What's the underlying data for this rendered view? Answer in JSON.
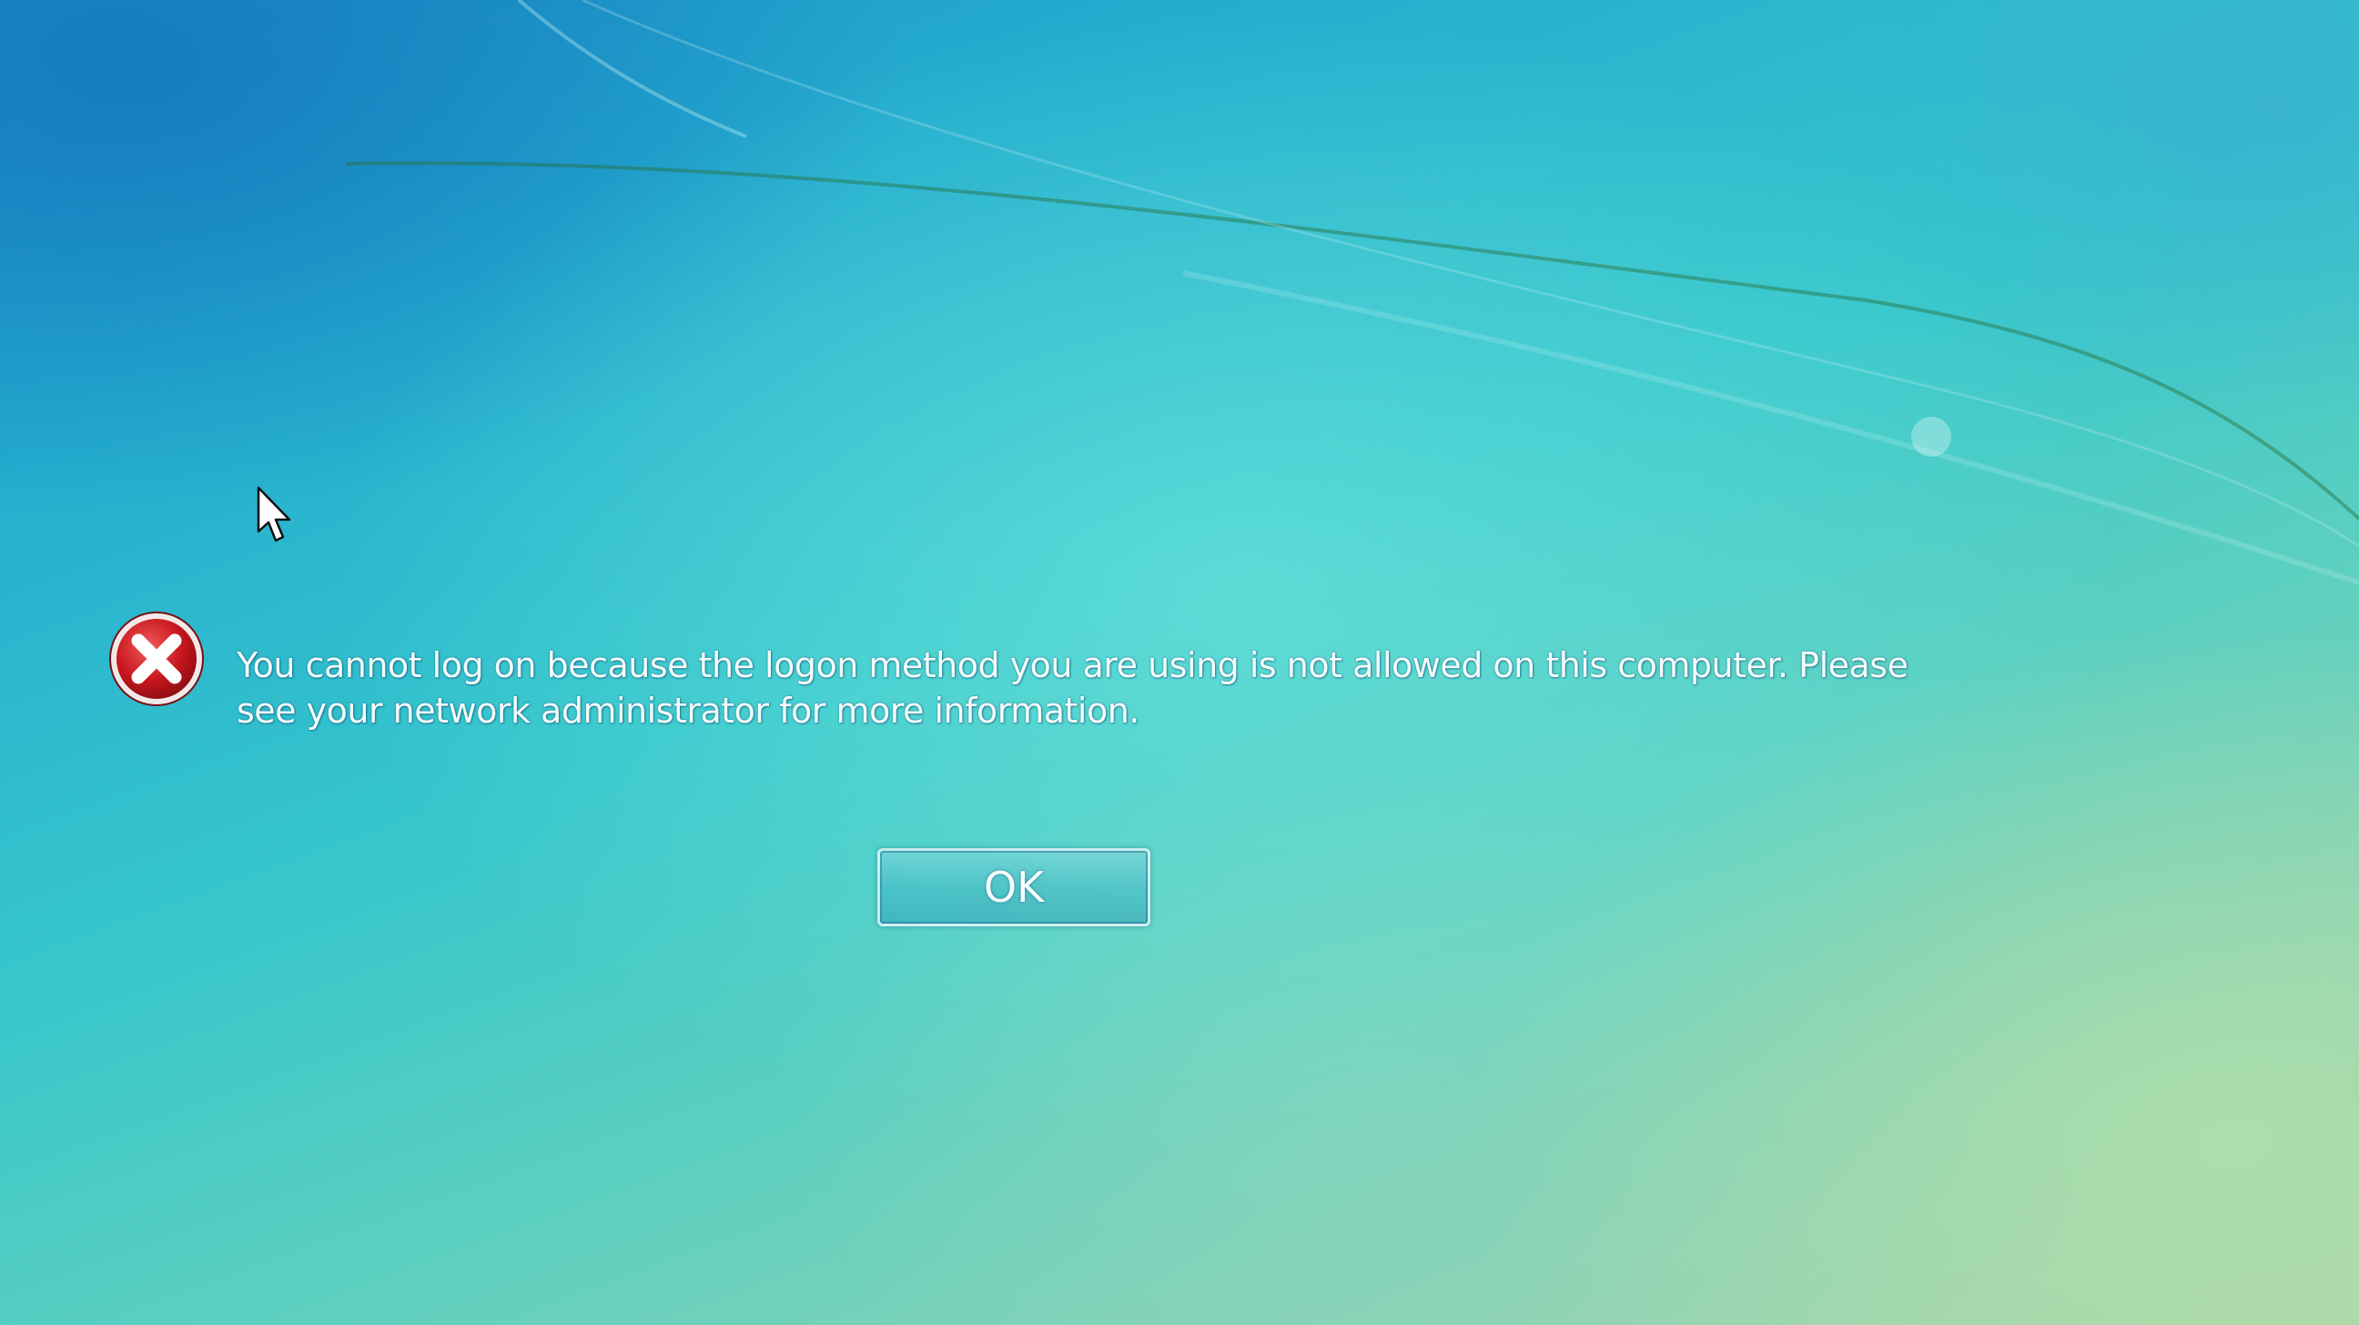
{
  "dialog": {
    "message": "You cannot log on because the logon method you are using is not allowed on this computer. Please see your network administrator for more information.",
    "ok_label": "OK",
    "icon": "error-icon"
  },
  "colors": {
    "error_red": "#c8171e",
    "text": "#f4fbfb",
    "background_blue": "#25afcf",
    "background_green": "#a9d3a8"
  }
}
